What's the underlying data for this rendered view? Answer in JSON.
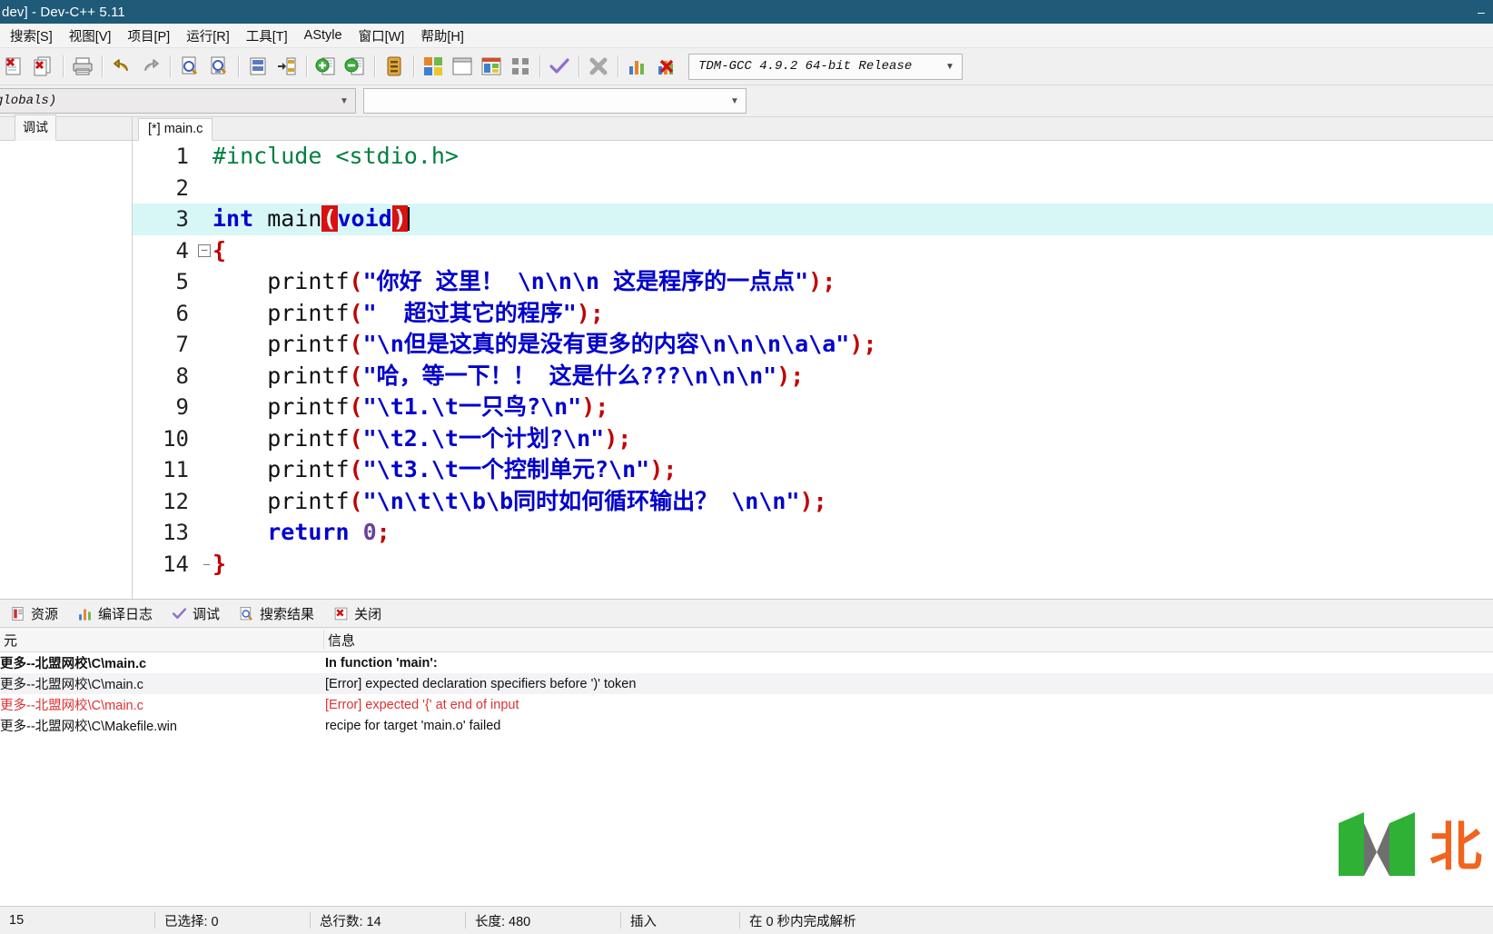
{
  "window": {
    "title": "dev] - Dev-C++ 5.11",
    "minimize_label": "–",
    "accent": "#1f5a78"
  },
  "menu": {
    "items": [
      {
        "label": "搜索[S]"
      },
      {
        "label": "视图[V]"
      },
      {
        "label": "项目[P]"
      },
      {
        "label": "运行[R]"
      },
      {
        "label": "工具[T]"
      },
      {
        "label": "AStyle"
      },
      {
        "label": "窗口[W]"
      },
      {
        "label": "帮助[H]"
      }
    ]
  },
  "toolbar": {
    "icons": [
      {
        "name": "close-file-icon"
      },
      {
        "name": "close-all-icon"
      },
      {
        "name": "print-icon"
      },
      {
        "name": "undo-icon"
      },
      {
        "name": "redo-icon"
      },
      {
        "name": "find-icon"
      },
      {
        "name": "find-next-icon"
      },
      {
        "name": "goto-line-icon"
      },
      {
        "name": "replace-icon"
      },
      {
        "name": "add-to-project-icon"
      },
      {
        "name": "remove-from-project-icon"
      },
      {
        "name": "project-options-icon"
      },
      {
        "name": "compile-icon"
      },
      {
        "name": "run-icon"
      },
      {
        "name": "compile-run-icon"
      },
      {
        "name": "rebuild-all-icon"
      },
      {
        "name": "syntax-check-icon"
      },
      {
        "name": "stop-execution-icon"
      },
      {
        "name": "profile-icon"
      },
      {
        "name": "delete-profile-icon"
      }
    ],
    "compiler_set": {
      "value": "TDM-GCC 4.9.2 64-bit Release",
      "arrow": "▼"
    }
  },
  "combo_row": {
    "scope": {
      "value": "globals)",
      "arrow": "▼"
    },
    "member": {
      "value": "",
      "arrow": "▼"
    }
  },
  "left_panel": {
    "tabs": [
      {
        "label": "",
        "selected": false
      },
      {
        "label": "调试",
        "selected": true
      }
    ]
  },
  "editor": {
    "tab": {
      "label": "[*] main.c"
    },
    "current_line": 3,
    "lines": [
      {
        "n": "1",
        "fold": "",
        "tokens": [
          {
            "t": "#include",
            "c": "pp"
          },
          {
            "t": " ",
            "c": "id"
          },
          {
            "t": "<stdio.h>",
            "c": "pp"
          }
        ]
      },
      {
        "n": "2",
        "fold": "",
        "tokens": []
      },
      {
        "n": "3",
        "fold": "",
        "tokens": [
          {
            "t": "int",
            "c": "k"
          },
          {
            "t": " ",
            "c": "id"
          },
          {
            "t": "main",
            "c": "id"
          },
          {
            "t": "(",
            "c": "hl"
          },
          {
            "t": "void",
            "c": "k"
          },
          {
            "t": ")",
            "c": "hl"
          },
          {
            "t": "CARET",
            "c": "caret"
          }
        ]
      },
      {
        "n": "4",
        "fold": "-",
        "tokens": [
          {
            "t": "{",
            "c": "brace"
          }
        ]
      },
      {
        "n": "5",
        "fold": "|",
        "tokens": [
          {
            "t": "    printf",
            "c": "id"
          },
          {
            "t": "(",
            "c": "sym"
          },
          {
            "t": "\"你好 这里！ ",
            "c": "str"
          },
          {
            "t": "\\n\\n\\n",
            "c": "esc"
          },
          {
            "t": " 这是程序的一点点\"",
            "c": "str"
          },
          {
            "t": ")",
            "c": "sym"
          },
          {
            "t": ";",
            "c": "sym"
          }
        ]
      },
      {
        "n": "6",
        "fold": "|",
        "tokens": [
          {
            "t": "    printf",
            "c": "id"
          },
          {
            "t": "(",
            "c": "sym"
          },
          {
            "t": "\"  超过其它的程序\"",
            "c": "str"
          },
          {
            "t": ")",
            "c": "sym"
          },
          {
            "t": ";",
            "c": "sym"
          }
        ]
      },
      {
        "n": "7",
        "fold": "|",
        "tokens": [
          {
            "t": "    printf",
            "c": "id"
          },
          {
            "t": "(",
            "c": "sym"
          },
          {
            "t": "\"",
            "c": "str"
          },
          {
            "t": "\\n",
            "c": "esc"
          },
          {
            "t": "但是这真的是没有更多的内容",
            "c": "str"
          },
          {
            "t": "\\n\\n\\n\\a\\a",
            "c": "esc"
          },
          {
            "t": "\"",
            "c": "str"
          },
          {
            "t": ")",
            "c": "sym"
          },
          {
            "t": ";",
            "c": "sym"
          }
        ]
      },
      {
        "n": "8",
        "fold": "|",
        "tokens": [
          {
            "t": "    printf",
            "c": "id"
          },
          {
            "t": "(",
            "c": "sym"
          },
          {
            "t": "\"哈，等一下！！ 这是什么???",
            "c": "str"
          },
          {
            "t": "\\n\\n\\n",
            "c": "esc"
          },
          {
            "t": "\"",
            "c": "str"
          },
          {
            "t": ")",
            "c": "sym"
          },
          {
            "t": ";",
            "c": "sym"
          }
        ]
      },
      {
        "n": "9",
        "fold": "|",
        "tokens": [
          {
            "t": "    printf",
            "c": "id"
          },
          {
            "t": "(",
            "c": "sym"
          },
          {
            "t": "\"",
            "c": "str"
          },
          {
            "t": "\\t",
            "c": "esc"
          },
          {
            "t": "1.",
            "c": "str"
          },
          {
            "t": "\\t",
            "c": "esc"
          },
          {
            "t": "一只鸟?",
            "c": "str"
          },
          {
            "t": "\\n",
            "c": "esc"
          },
          {
            "t": "\"",
            "c": "str"
          },
          {
            "t": ")",
            "c": "sym"
          },
          {
            "t": ";",
            "c": "sym"
          }
        ]
      },
      {
        "n": "10",
        "fold": "|",
        "tokens": [
          {
            "t": "    printf",
            "c": "id"
          },
          {
            "t": "(",
            "c": "sym"
          },
          {
            "t": "\"",
            "c": "str"
          },
          {
            "t": "\\t",
            "c": "esc"
          },
          {
            "t": "2.",
            "c": "str"
          },
          {
            "t": "\\t",
            "c": "esc"
          },
          {
            "t": "一个计划?",
            "c": "str"
          },
          {
            "t": "\\n",
            "c": "esc"
          },
          {
            "t": "\"",
            "c": "str"
          },
          {
            "t": ")",
            "c": "sym"
          },
          {
            "t": ";",
            "c": "sym"
          }
        ]
      },
      {
        "n": "11",
        "fold": "|",
        "tokens": [
          {
            "t": "    printf",
            "c": "id"
          },
          {
            "t": "(",
            "c": "sym"
          },
          {
            "t": "\"",
            "c": "str"
          },
          {
            "t": "\\t",
            "c": "esc"
          },
          {
            "t": "3.",
            "c": "str"
          },
          {
            "t": "\\t",
            "c": "esc"
          },
          {
            "t": "一个控制单元?",
            "c": "str"
          },
          {
            "t": "\\n",
            "c": "esc"
          },
          {
            "t": "\"",
            "c": "str"
          },
          {
            "t": ")",
            "c": "sym"
          },
          {
            "t": ";",
            "c": "sym"
          }
        ]
      },
      {
        "n": "12",
        "fold": "|",
        "tokens": [
          {
            "t": "    printf",
            "c": "id"
          },
          {
            "t": "(",
            "c": "sym"
          },
          {
            "t": "\"",
            "c": "str"
          },
          {
            "t": "\\n\\t\\t\\b\\b",
            "c": "esc"
          },
          {
            "t": "同时如何循环输出？ ",
            "c": "str"
          },
          {
            "t": "\\n\\n",
            "c": "esc"
          },
          {
            "t": "\"",
            "c": "str"
          },
          {
            "t": ")",
            "c": "sym"
          },
          {
            "t": ";",
            "c": "sym"
          }
        ]
      },
      {
        "n": "13",
        "fold": "|",
        "tokens": [
          {
            "t": "    ",
            "c": "id"
          },
          {
            "t": "return",
            "c": "k"
          },
          {
            "t": " ",
            "c": "id"
          },
          {
            "t": "0",
            "c": "num"
          },
          {
            "t": ";",
            "c": "sym"
          }
        ]
      },
      {
        "n": "14",
        "fold": "L",
        "tokens": [
          {
            "t": "}",
            "c": "brace"
          }
        ]
      }
    ]
  },
  "bottom_panel": {
    "tabs": [
      {
        "label": "资源",
        "icon": "resources-icon"
      },
      {
        "label": "编译日志",
        "icon": "compile-log-icon"
      },
      {
        "label": "调试",
        "icon": "debug-check-icon"
      },
      {
        "label": "搜索结果",
        "icon": "search-results-icon"
      },
      {
        "label": "关闭",
        "icon": "close-panel-icon"
      }
    ],
    "columns": [
      "元",
      "信息"
    ],
    "rows": [
      {
        "file": "更多--北盟网校\\C\\main.c",
        "message": "In function 'main':",
        "style": "bold"
      },
      {
        "file": "更多--北盟网校\\C\\main.c",
        "message": "[Error] expected declaration specifiers before ')' token",
        "style": "alt"
      },
      {
        "file": "更多--北盟网校\\C\\main.c",
        "message": "[Error] expected '{' at end of input",
        "style": "err"
      },
      {
        "file": "更多--北盟网校\\C\\Makefile.win",
        "message": "recipe for target 'main.o' failed",
        "style": ""
      }
    ]
  },
  "status_bar": {
    "items": [
      {
        "label": "15"
      },
      {
        "label": "已选择:  0"
      },
      {
        "label": "总行数:  14"
      },
      {
        "label": "长度:  480"
      },
      {
        "label": "插入"
      },
      {
        "label": "在 0 秒内完成解析"
      }
    ]
  },
  "watermark": {
    "brand_char": "北",
    "brand_color": "#2eb135",
    "accent_color": "#f0641e"
  }
}
